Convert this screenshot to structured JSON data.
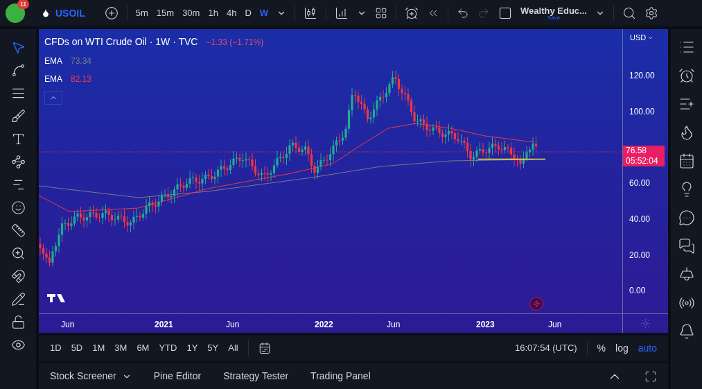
{
  "top_bar": {
    "notification_count": "11",
    "symbol": "USOIL",
    "intervals": [
      {
        "label": "5m",
        "selected": false
      },
      {
        "label": "15m",
        "selected": false
      },
      {
        "label": "30m",
        "selected": false
      },
      {
        "label": "1h",
        "selected": false
      },
      {
        "label": "4h",
        "selected": false
      },
      {
        "label": "D",
        "selected": false
      },
      {
        "label": "W",
        "selected": true
      }
    ],
    "redo_disabled": true,
    "layout_name": "Wealthy Educ...",
    "save_label": "Save"
  },
  "left_tools": [
    {
      "kind": "cursor",
      "selected": true
    },
    {
      "kind": "trendline",
      "selected": false
    },
    {
      "kind": "fib",
      "selected": false
    },
    {
      "kind": "brush",
      "selected": false
    },
    {
      "kind": "text",
      "selected": false
    },
    {
      "kind": "pattern",
      "selected": false
    },
    {
      "kind": "prediction",
      "selected": false
    },
    {
      "kind": "emoji",
      "selected": false
    },
    {
      "kind": "ruler",
      "selected": false
    },
    {
      "kind": "zoom",
      "selected": false
    },
    {
      "kind": "magnet",
      "selected": false
    },
    {
      "kind": "lockdraw",
      "selected": false
    },
    {
      "kind": "lock",
      "selected": false
    },
    {
      "kind": "eye",
      "selected": false
    }
  ],
  "chart": {
    "title": "CFDs on WTI Crude Oil · 1W · TVC",
    "change": "−1.33 (−1.71%)",
    "indicators": [
      {
        "name": "EMA",
        "value": "73.34",
        "color": "#787b86"
      },
      {
        "name": "EMA",
        "value": "82.13",
        "color": "#f23645"
      }
    ],
    "currency": "USD",
    "y_ticks": [
      "120.00",
      "100.00",
      "60.00",
      "40.00",
      "20.00",
      "0.00"
    ],
    "x_labels": [
      {
        "label": "Jun",
        "major": false
      },
      {
        "label": "2021",
        "major": true
      },
      {
        "label": "Jun",
        "major": false
      },
      {
        "label": "2022",
        "major": true
      },
      {
        "label": "Jun",
        "major": false
      },
      {
        "label": "2023",
        "major": true
      },
      {
        "label": "Jun",
        "major": false
      }
    ],
    "last_price": "76.58",
    "countdown": "05:52:04"
  },
  "range_buttons": [
    "1D",
    "5D",
    "1M",
    "3M",
    "6M",
    "YTD",
    "1Y",
    "5Y",
    "All"
  ],
  "clock": "16:07:54 (UTC)",
  "scale_toggles": [
    {
      "label": "%",
      "on": false
    },
    {
      "label": "log",
      "on": false
    },
    {
      "label": "auto",
      "on": true
    }
  ],
  "bottom_tabs": [
    {
      "label": "Stock Screener",
      "dropdown": true
    },
    {
      "label": "Pine Editor",
      "dropdown": false
    },
    {
      "label": "Strategy Tester",
      "dropdown": false
    },
    {
      "label": "Trading Panel",
      "dropdown": false
    }
  ]
}
